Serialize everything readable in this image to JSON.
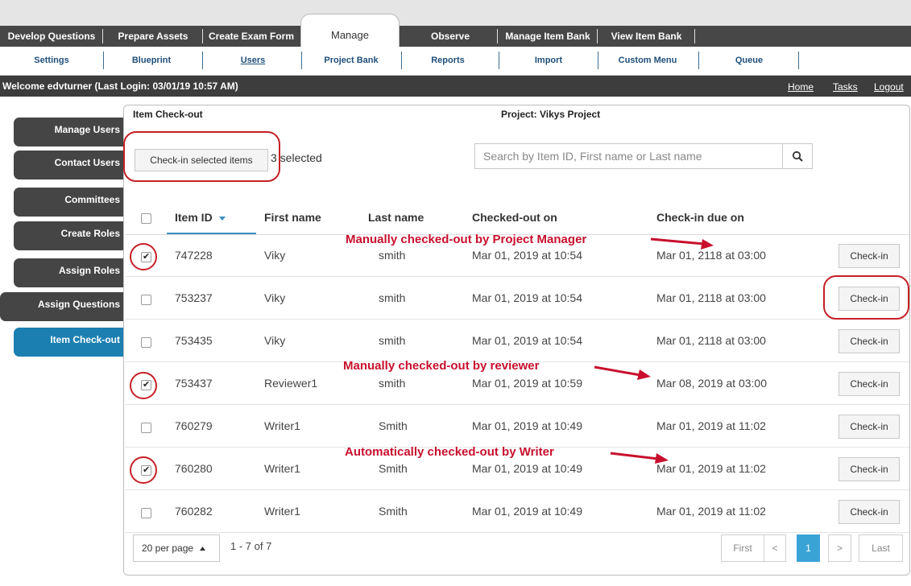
{
  "main_tabs": [
    {
      "label": "Develop Questions"
    },
    {
      "label": "Prepare Assets"
    },
    {
      "label": "Create Exam Form"
    },
    {
      "label": "Manage"
    },
    {
      "label": "Observe"
    },
    {
      "label": "Manage Item Bank"
    },
    {
      "label": "View Item Bank"
    }
  ],
  "sub_tabs": [
    {
      "label": "Settings"
    },
    {
      "label": "Blueprint"
    },
    {
      "label": "Users"
    },
    {
      "label": "Project Bank"
    },
    {
      "label": "Reports"
    },
    {
      "label": "Import"
    },
    {
      "label": "Custom Menu"
    },
    {
      "label": "Queue"
    }
  ],
  "welcome": "Welcome edvturner (Last Login: 03/01/19   10:57 AM)",
  "header_links": {
    "home": "Home",
    "tasks": "Tasks",
    "logout": "Logout"
  },
  "sidebar": [
    {
      "label": "Manage Users"
    },
    {
      "label": "Contact Users"
    },
    {
      "label": "Committees"
    },
    {
      "label": "Create Roles"
    },
    {
      "label": "Assign Roles"
    },
    {
      "label": "Assign Questions"
    },
    {
      "label": "Item Check-out"
    }
  ],
  "panel": {
    "title": "Item Check-out",
    "project": "Project: Vikys Project",
    "checkin_selected_label": "Check-in selected items",
    "selected_count": "3 selected",
    "search_placeholder": "Search by Item ID, First name or Last name"
  },
  "table": {
    "headers": {
      "item_id": "Item ID",
      "first_name": "First name",
      "last_name": "Last name",
      "checked_out_on": "Checked-out on",
      "checkin_due_on": "Check-in due on"
    },
    "sort_icon": "caret-down",
    "rows": [
      {
        "checked": true,
        "item_id": "747228",
        "first": "Viky",
        "last": "smith",
        "out": "Mar 01, 2019 at 10:54",
        "due": "Mar 01, 2118 at 03:00",
        "action": "Check-in"
      },
      {
        "checked": false,
        "item_id": "753237",
        "first": "Viky",
        "last": "smith",
        "out": "Mar 01, 2019 at 10:54",
        "due": "Mar 01, 2118 at 03:00",
        "action": "Check-in"
      },
      {
        "checked": false,
        "item_id": "753435",
        "first": "Viky",
        "last": "smith",
        "out": "Mar 01, 2019 at 10:54",
        "due": "Mar 01, 2118 at 03:00",
        "action": "Check-in"
      },
      {
        "checked": true,
        "item_id": "753437",
        "first": "Reviewer1",
        "last": "smith",
        "out": "Mar 01, 2019 at 10:59",
        "due": "Mar 08, 2019 at 03:00",
        "action": "Check-in"
      },
      {
        "checked": false,
        "item_id": "760279",
        "first": "Writer1",
        "last": "Smith",
        "out": "Mar 01, 2019 at 10:49",
        "due": "Mar 01, 2019 at 11:02",
        "action": "Check-in"
      },
      {
        "checked": true,
        "item_id": "760280",
        "first": "Writer1",
        "last": "Smith",
        "out": "Mar 01, 2019 at 10:49",
        "due": "Mar 01, 2019 at 11:02",
        "action": "Check-in"
      },
      {
        "checked": false,
        "item_id": "760282",
        "first": "Writer1",
        "last": "Smith",
        "out": "Mar 01, 2019 at 10:49",
        "due": "Mar 01, 2019 at 11:02",
        "action": "Check-in"
      }
    ]
  },
  "pagination": {
    "per_page": "20 per page",
    "range": "1 - 7 of 7",
    "first": "First",
    "prev": "<",
    "current": "1",
    "next": ">",
    "last": "Last"
  },
  "annotations": {
    "note1": "Manually checked-out by Project Manager",
    "note2": "Manually checked-out by reviewer",
    "note3": "Automatically checked-out by Writer"
  },
  "colors": {
    "accent": "#1b7fb1",
    "annotation": "#c8102e",
    "nav_dark": "#474747"
  }
}
